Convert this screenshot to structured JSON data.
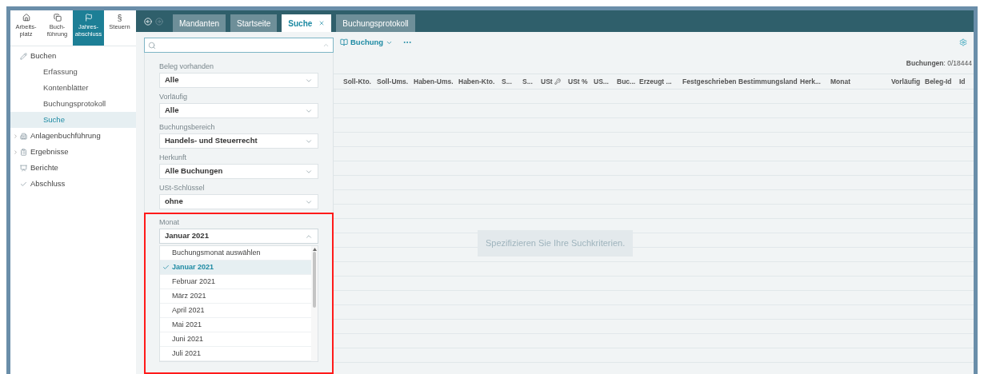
{
  "nav": [
    {
      "lines": [
        "Arbeits-",
        "platz"
      ],
      "kind": "home",
      "selected": false
    },
    {
      "lines": [
        "Buch-",
        "führung"
      ],
      "kind": "copy",
      "selected": false
    },
    {
      "lines": [
        "Jahres-",
        "abschluss"
      ],
      "kind": "flag",
      "selected": true
    },
    {
      "lines": [
        "Steuern"
      ],
      "glyph": "§",
      "selected": false
    }
  ],
  "sidebar": {
    "items": [
      {
        "label": "Buchen",
        "kind": "pencil",
        "selected": false,
        "children": [
          {
            "label": "Erfassung",
            "selected": false
          },
          {
            "label": "Kontenblätter",
            "selected": false
          },
          {
            "label": "Buchungsprotokoll",
            "selected": false
          },
          {
            "label": "Suche",
            "selected": true
          }
        ]
      },
      {
        "label": "Anlagenbuchführung",
        "kind": "building",
        "expanded": false,
        "selected": false
      },
      {
        "label": "Ergebnisse",
        "kind": "clipboard",
        "expanded": false,
        "selected": false
      },
      {
        "label": "Berichte",
        "kind": "presentation",
        "selected": false
      },
      {
        "label": "Abschluss",
        "kind": "check",
        "selected": false
      }
    ]
  },
  "tabs": [
    {
      "label": "Mandanten",
      "selected": false,
      "closable": false
    },
    {
      "label": "Startseite",
      "selected": false,
      "closable": false
    },
    {
      "label": "Suche",
      "selected": true,
      "closable": true
    },
    {
      "label": "Buchungsprotokoll",
      "selected": false,
      "closable": false
    }
  ],
  "filters": [
    {
      "label": "Beleg vorhanden",
      "value": "Alle",
      "open": false,
      "highlighted": false
    },
    {
      "label": "Vorläufig",
      "value": "Alle",
      "open": false,
      "highlighted": false
    },
    {
      "label": "Buchungsbereich",
      "value": "Handels- und Steuerrecht",
      "open": false,
      "highlighted": false
    },
    {
      "label": "Herkunft",
      "value": "Alle Buchungen",
      "open": false,
      "highlighted": false
    },
    {
      "label": "USt-Schlüssel",
      "value": "ohne",
      "open": false,
      "highlighted": false
    },
    {
      "label": "Monat",
      "value": "Januar 2021",
      "open": true,
      "highlighted": true,
      "options": [
        {
          "label": "Buchungsmonat auswählen",
          "selected": false
        },
        {
          "label": "Januar 2021",
          "selected": true
        },
        {
          "label": "Februar 2021",
          "selected": false
        },
        {
          "label": "März 2021",
          "selected": false
        },
        {
          "label": "April 2021",
          "selected": false
        },
        {
          "label": "Mai 2021",
          "selected": false
        },
        {
          "label": "Juni 2021",
          "selected": false
        },
        {
          "label": "Juli 2021",
          "selected": false
        }
      ]
    }
  ],
  "toolbar": {
    "button": "Buchung"
  },
  "record_count": "**Buchungen**: 0/18444",
  "table": {
    "columns": [
      {
        "label": "Soll-Kto."
      },
      {
        "label": "Soll-Ums."
      },
      {
        "label": "Haben-Ums."
      },
      {
        "label": "Haben-Kto."
      },
      {
        "label": "S..."
      },
      {
        "label": "S..."
      },
      {
        "label": "USt",
        "kind": "key"
      },
      {
        "label": "USt %"
      },
      {
        "label": "US..."
      },
      {
        "label": "Buc..."
      },
      {
        "label": "Erzeugt ..."
      },
      {
        "label": "Festgeschrieben"
      },
      {
        "label": "Bestimmungsland"
      },
      {
        "label": "Herk..."
      },
      {
        "label": "Monat"
      },
      {
        "label": "Vorläufig"
      },
      {
        "label": "Beleg-Id"
      },
      {
        "label": "Id"
      }
    ]
  },
  "empty_message": "Spezifizieren Sie Ihre Suchkriterien."
}
